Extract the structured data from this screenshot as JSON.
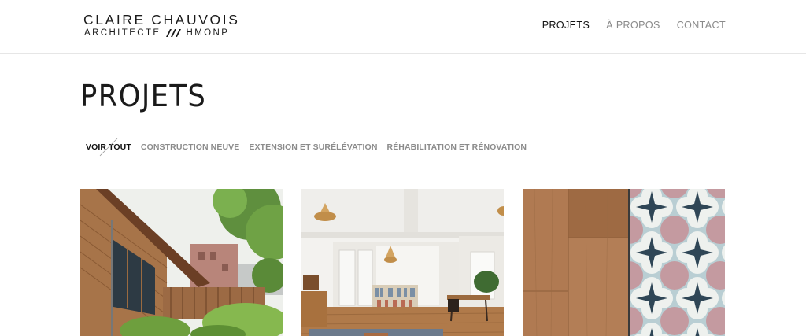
{
  "brand": {
    "name": "CLAIRE CHAUVOIS",
    "subtitle_left": "ARCHITECTE",
    "subtitle_right": "HMONP"
  },
  "nav": {
    "items": [
      {
        "label": "PROJETS",
        "active": true
      },
      {
        "label": "À PROPOS",
        "active": false
      },
      {
        "label": "CONTACT",
        "active": false
      }
    ]
  },
  "page": {
    "title": "PROJETS"
  },
  "filters": {
    "items": [
      {
        "label": "VOIR TOUT",
        "active": true
      },
      {
        "label": "CONSTRUCTION NEUVE",
        "active": false
      },
      {
        "label": "EXTENSION ET SURÉLÉVATION",
        "active": false
      },
      {
        "label": "RÉHABILITATION ET RÉNOVATION",
        "active": false
      }
    ]
  },
  "projects": [
    {
      "image": "wooden-house-exterior-photo"
    },
    {
      "image": "bright-apartment-interior-photo"
    },
    {
      "image": "wood-floor-and-cement-tiles-photo"
    }
  ],
  "colors": {
    "text_primary": "#111111",
    "text_muted": "#8a8a8a",
    "header_border": "#e6e6e6"
  }
}
